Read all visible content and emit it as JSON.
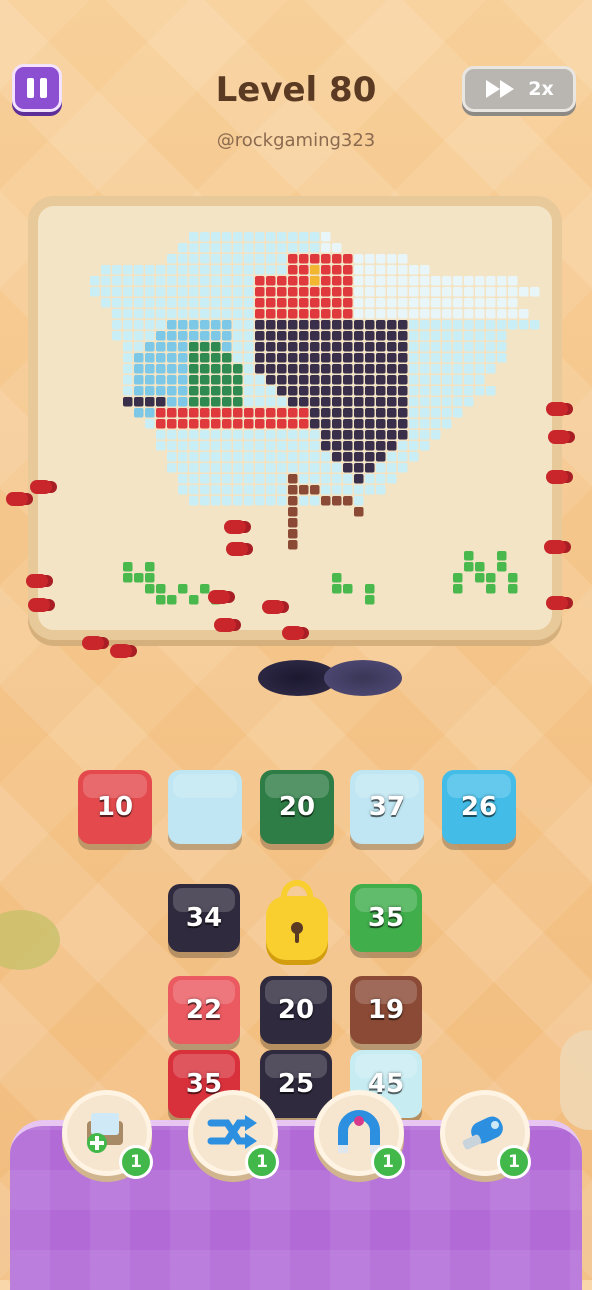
{
  "header": {
    "title": "Level 80",
    "subtitle": "@rockgaming323",
    "speed_label": "2x"
  },
  "queue": [
    {
      "value": "10",
      "color": "#e44a4d"
    },
    {
      "value": "",
      "color": "#bfe6f2"
    },
    {
      "value": "20",
      "color": "#2f7d46"
    },
    {
      "value": "37",
      "color": "#bfe6f2"
    },
    {
      "value": "26",
      "color": "#43bde8"
    }
  ],
  "grid": [
    {
      "value": "34",
      "color": "#2f2a3e",
      "col": 0,
      "row": 0
    },
    {
      "value": "35",
      "color": "#3fae4b",
      "col": 2,
      "row": 0
    },
    {
      "value": "22",
      "color": "#ea5a60",
      "col": 0,
      "row": 1
    },
    {
      "value": "20",
      "color": "#2f2a3e",
      "col": 1,
      "row": 1
    },
    {
      "value": "19",
      "color": "#8a4a35",
      "col": 2,
      "row": 1
    },
    {
      "value": "35",
      "color": "#d9313c",
      "col": 0,
      "row": 2
    },
    {
      "value": "25",
      "color": "#2f2a3e",
      "col": 1,
      "row": 2
    },
    {
      "value": "45",
      "color": "#c7ecf2",
      "col": 2,
      "row": 2
    }
  ],
  "boosters": [
    {
      "name": "add-slot",
      "count": "1"
    },
    {
      "name": "shuffle",
      "count": "1"
    },
    {
      "name": "magnet",
      "count": "1"
    },
    {
      "name": "vacuum",
      "count": "1"
    }
  ],
  "colors": {
    "sky": "#c9eef6",
    "water": "#7cc8e6",
    "bird_red": "#e0393d",
    "bird_body": "#3a2f4a",
    "leaf": "#2f8a52",
    "grass": "#49b94e",
    "branch": "#8a4a35"
  }
}
